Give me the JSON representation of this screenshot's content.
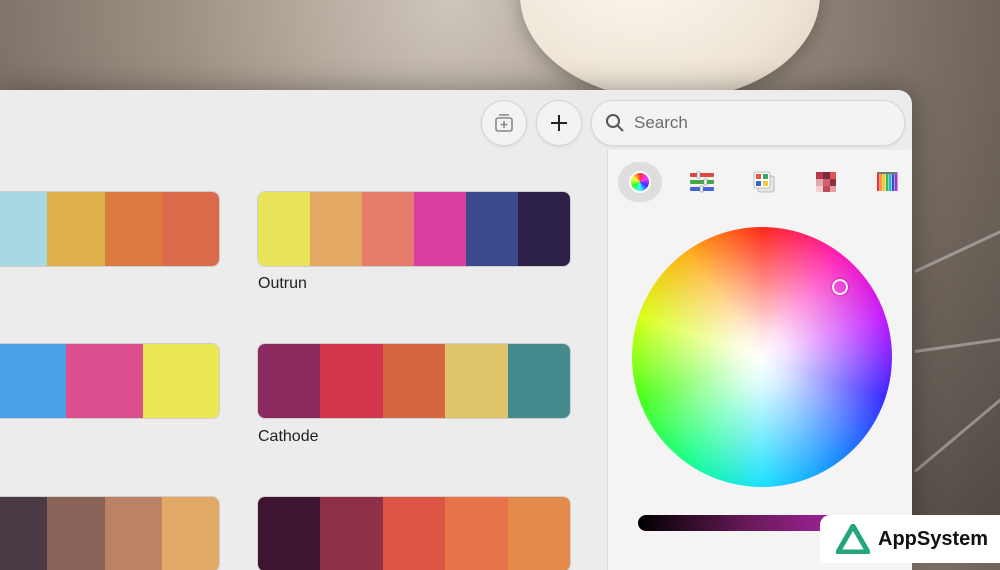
{
  "toolbar": {
    "new_collection_icon": "add-to-collection-icon",
    "add_icon": "plus-icon"
  },
  "search": {
    "placeholder": "Search",
    "icon": "search-icon"
  },
  "palettes": [
    {
      "label": "",
      "colors": [
        "#a8d8e2",
        "#e0b04a",
        "#da7a3f",
        "#d96b4b"
      ]
    },
    {
      "label": "Outrun",
      "colors": [
        "#e9e45a",
        "#e2a864",
        "#e67b6b",
        "#d83e9d",
        "#3a4a8c",
        "#2d2048"
      ]
    },
    {
      "label": "",
      "colors": [
        "#4aa0e6",
        "#dd4e8f",
        "#ece855"
      ]
    },
    {
      "label": "Cathode",
      "colors": [
        "#8a2a5e",
        "#d3364c",
        "#d5673f",
        "#e0c46a",
        "#458a8c"
      ]
    },
    {
      "label": "",
      "colors": [
        "#4a3a44",
        "#8b6258",
        "#bd8266",
        "#e2a866"
      ]
    },
    {
      "label": "",
      "colors": [
        "#3d1530",
        "#8e3048",
        "#dc5544",
        "#e7734b",
        "#e38a4a"
      ]
    }
  ],
  "picker": {
    "tabs": [
      {
        "name": "color-wheel",
        "active": true
      },
      {
        "name": "color-sliders",
        "active": false
      },
      {
        "name": "color-palettes",
        "active": false
      },
      {
        "name": "image-palettes",
        "active": false
      },
      {
        "name": "pencils",
        "active": false
      }
    ],
    "brightness_slider_gradient": [
      "#000000",
      "#c228c0"
    ]
  },
  "watermark": {
    "brand": "AppSystem"
  }
}
